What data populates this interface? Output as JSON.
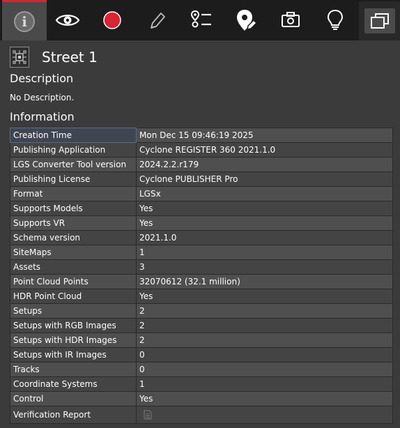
{
  "toolbar": {
    "items": [
      {
        "icon": "info-icon",
        "active": true
      },
      {
        "icon": "eye-icon",
        "active": false
      },
      {
        "icon": "record-icon",
        "active": false
      },
      {
        "icon": "pencil-icon",
        "active": false
      },
      {
        "icon": "route-list-icon",
        "active": false
      },
      {
        "icon": "location-edit-icon",
        "active": false
      },
      {
        "icon": "camera-icon",
        "active": false
      },
      {
        "icon": "lightbulb-icon",
        "active": false
      }
    ],
    "right_icon": "window-restore-icon",
    "accent_color": "#d82433"
  },
  "header": {
    "title": "Street 1",
    "icon": "sitemap-icon"
  },
  "description": {
    "heading": "Description",
    "text": "No Description."
  },
  "information": {
    "heading": "Information",
    "rows": [
      {
        "key": "Creation Time",
        "value": "Mon Dec 15 09:46:19 2025"
      },
      {
        "key": "Publishing Application",
        "value": "Cyclone REGISTER 360 2021.1.0"
      },
      {
        "key": "LGS Converter Tool version",
        "value": "2024.2.2.r179"
      },
      {
        "key": "Publishing License",
        "value": "Cyclone PUBLISHER Pro"
      },
      {
        "key": "Format",
        "value": "LGSx"
      },
      {
        "key": "Supports Models",
        "value": "Yes"
      },
      {
        "key": "Supports VR",
        "value": "Yes"
      },
      {
        "key": "Schema version",
        "value": "2021.1.0"
      },
      {
        "key": "SiteMaps",
        "value": "1"
      },
      {
        "key": "Assets",
        "value": "3"
      },
      {
        "key": "Point Cloud Points",
        "value": "32070612 (32.1 million)"
      },
      {
        "key": "HDR Point Cloud",
        "value": "Yes"
      },
      {
        "key": "Setups",
        "value": "2"
      },
      {
        "key": "Setups with RGB Images",
        "value": "2"
      },
      {
        "key": "Setups with HDR Images",
        "value": "2"
      },
      {
        "key": "Setups with IR Images",
        "value": "0"
      },
      {
        "key": "Tracks",
        "value": "0"
      },
      {
        "key": "Coordinate Systems",
        "value": "1"
      },
      {
        "key": "Control",
        "value": "Yes"
      },
      {
        "key": "Verification Report",
        "value": "",
        "icon": "document-icon"
      }
    ]
  }
}
